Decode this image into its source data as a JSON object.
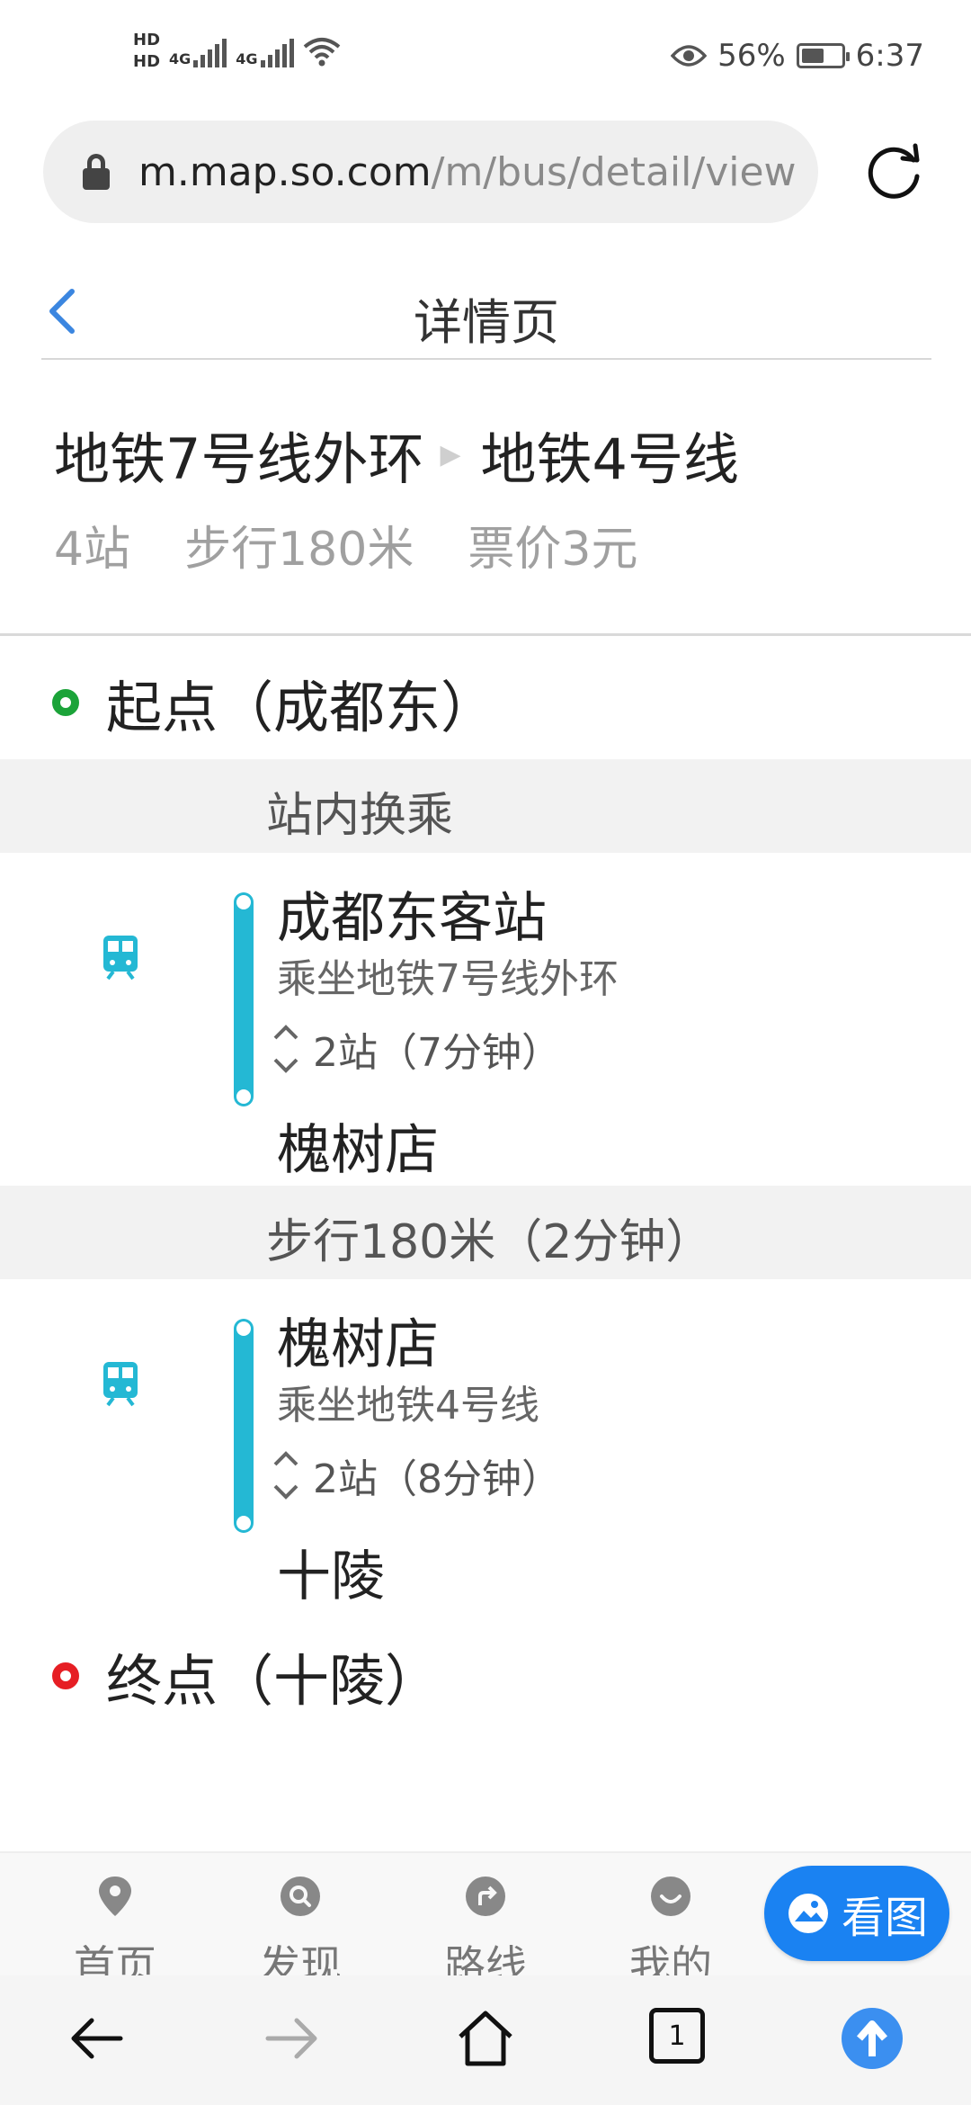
{
  "status_bar": {
    "hd1": "HD",
    "hd2": "HD",
    "net1": "4G",
    "net2": "4G",
    "eye_percent": "56%",
    "time": "6:37"
  },
  "url_bar": {
    "domain": "m.map.so.com",
    "path": "/m/bus/detail/view"
  },
  "header": {
    "title": "详情页"
  },
  "summary": {
    "from_line": "地铁7号线外环",
    "to_line": "地铁4号线",
    "stops": "4站",
    "walk": "步行180米",
    "fare": "票价3元"
  },
  "route": {
    "start_label": "起点（成都东）",
    "transfer1": "站内换乘",
    "segment1": {
      "board_stop": "成都东客站",
      "ride": "乘坐地铁7号线外环",
      "count": "2站（7分钟）",
      "alight_stop": "槐树店"
    },
    "transfer2": "步行180米（2分钟）",
    "segment2": {
      "board_stop": "槐树店",
      "ride": "乘坐地铁4号线",
      "count": "2站（8分钟）",
      "alight_stop": "十陵"
    },
    "end_label": "终点（十陵）"
  },
  "bottom_nav": {
    "home": "首页",
    "discover": "发现",
    "routes": "路线",
    "mine": "我的",
    "view_map": "看图"
  },
  "browser": {
    "tab_count": "1"
  },
  "colors": {
    "accent_blue": "#1a82f2",
    "route_cyan": "#24b8d4",
    "start_green": "#1ba339",
    "end_red": "#e61e24"
  }
}
